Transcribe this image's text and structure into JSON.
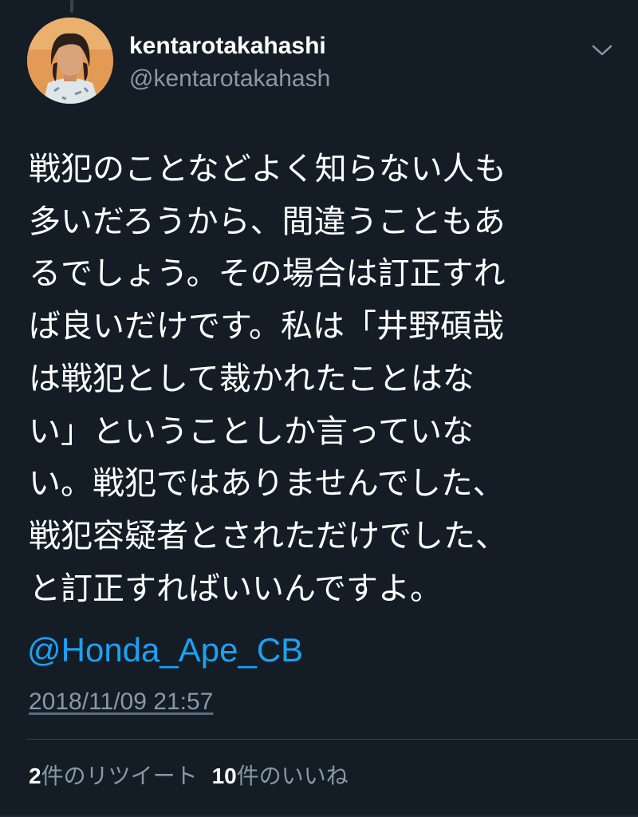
{
  "author": {
    "display_name": "kentarotakahashi",
    "handle": "@kentarotakahash"
  },
  "tweet": {
    "lines": [
      "戦犯のことなどよく知らない人も",
      "多いだろうから、間違うこともあ",
      "るでしょう。その場合は訂正すれ",
      "ば良いだけです。私は「井野碩哉",
      "は戦犯として裁かれたことはな",
      "い」ということしか言っていな",
      "い。戦犯ではありませんでした、",
      "戦犯容疑者とされただけでした、",
      "と訂正すればいいんですよ。"
    ],
    "mention": "@Honda_Ape_CB",
    "timestamp": "2018/11/09 21:57"
  },
  "stats": {
    "retweets_count": "2",
    "retweets_label": "件のリツイート",
    "likes_count": "10",
    "likes_label": "件のいいね"
  },
  "icons": {
    "menu": "chevron-down-icon"
  },
  "colors": {
    "background": "#141d26",
    "text": "#ffffff",
    "secondary": "#8899a6",
    "link": "#1da1f2"
  }
}
